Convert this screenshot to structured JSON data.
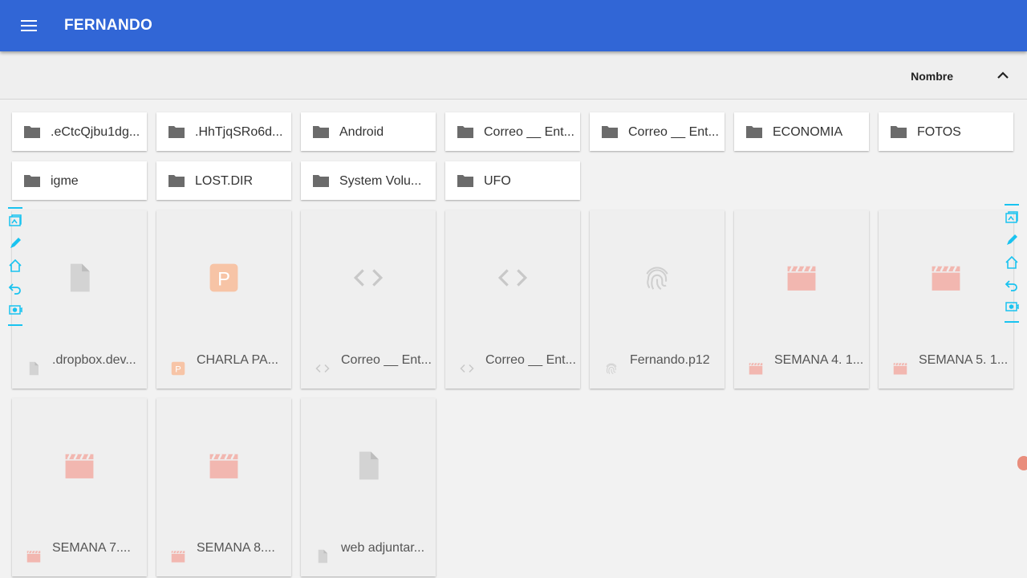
{
  "header": {
    "title": "FERNANDO",
    "menu_icon": "menu-icon",
    "color": "#3166d6"
  },
  "sort": {
    "label": "Nombre",
    "icon": "chevron-up-icon"
  },
  "folders": [
    {
      "name": ".eCtcQjbu1dg..."
    },
    {
      "name": ".HhTjqSRo6d..."
    },
    {
      "name": "Android"
    },
    {
      "name": "Correo __ Ent..."
    },
    {
      "name": "Correo __ Ent..."
    },
    {
      "name": "ECONOMIA"
    },
    {
      "name": "FOTOS"
    },
    {
      "name": "igme"
    },
    {
      "name": "LOST.DIR"
    },
    {
      "name": "System Volu..."
    },
    {
      "name": "UFO"
    }
  ],
  "files": [
    {
      "name": ".dropbox.dev...",
      "type": "document",
      "icon": "file-icon",
      "color": "#d3d3d3"
    },
    {
      "name": "CHARLA PA...",
      "type": "presentation",
      "icon": "presentation-icon",
      "color": "#f7c4a6"
    },
    {
      "name": "Correo __ Ent...",
      "type": "code",
      "icon": "code-icon",
      "color": "#c8c8c8"
    },
    {
      "name": "Correo __ Ent...",
      "type": "code",
      "icon": "code-icon",
      "color": "#c8c8c8"
    },
    {
      "name": "Fernando.p12",
      "type": "certificate",
      "icon": "fingerprint-icon",
      "color": "#cfcfcf"
    },
    {
      "name": "SEMANA 4. 1...",
      "type": "video",
      "icon": "movie-icon",
      "color": "#f2b7b0"
    },
    {
      "name": "SEMANA 5. 1...",
      "type": "video",
      "icon": "movie-icon",
      "color": "#f2b7b0"
    },
    {
      "name": "SEMANA 7....",
      "type": "video",
      "icon": "movie-icon",
      "color": "#f2b7b0"
    },
    {
      "name": "SEMANA 8....",
      "type": "video",
      "icon": "movie-icon",
      "color": "#f2b7b0"
    },
    {
      "name": "web adjuntar...",
      "type": "document",
      "icon": "file-icon",
      "color": "#d3d3d3"
    }
  ],
  "edge_tools": {
    "color": "#19c3f0",
    "icons": [
      "screenshot-icon",
      "pen-icon",
      "home-icon",
      "back-icon",
      "screen-record-icon"
    ]
  }
}
